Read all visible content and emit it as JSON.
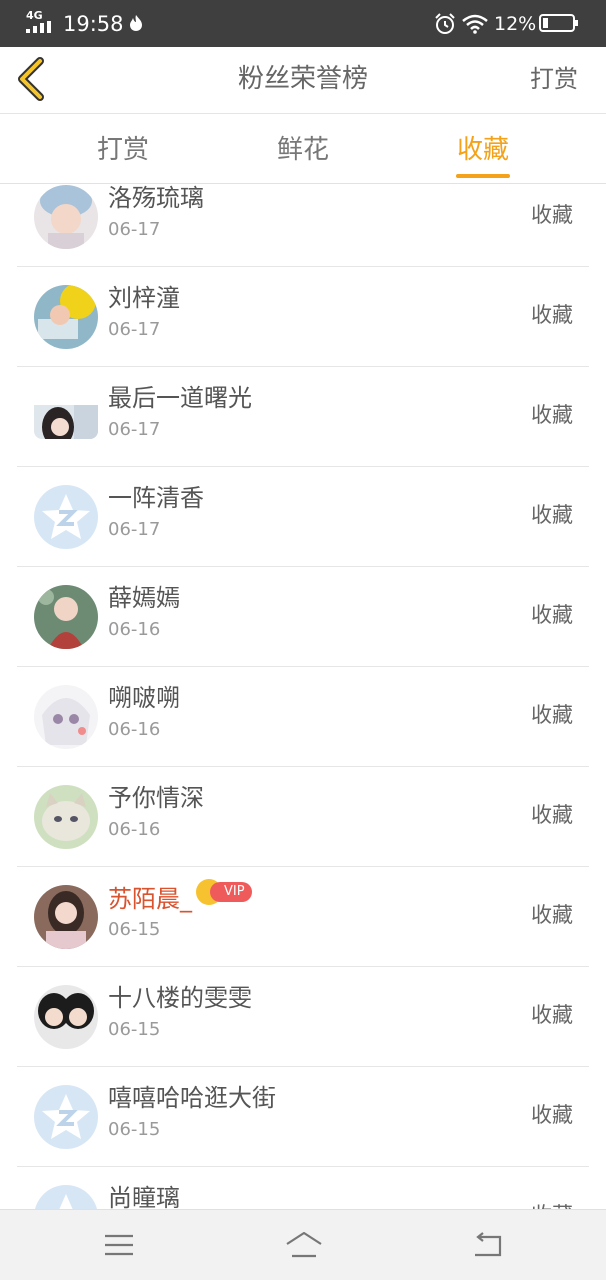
{
  "status_bar": {
    "network": "4G",
    "time": "19:58",
    "battery": "12%"
  },
  "header": {
    "title": "粉丝荣誉榜",
    "right_action": "打赏",
    "back_icon": "chevron-left-icon"
  },
  "tabs": [
    {
      "label": "打赏",
      "active": false
    },
    {
      "label": "鲜花",
      "active": false
    },
    {
      "label": "收藏",
      "active": true
    }
  ],
  "colors": {
    "accent": "#f3a21a",
    "vip_name": "#d9532f",
    "status_bar": "#3f3f3f"
  },
  "list": [
    {
      "name": "洛殇琉璃",
      "date": "06-17",
      "action": "收藏",
      "vip": false
    },
    {
      "name": "刘梓潼",
      "date": "06-17",
      "action": "收藏",
      "vip": false
    },
    {
      "name": "最后一道曙光",
      "date": "06-17",
      "action": "收藏",
      "vip": false
    },
    {
      "name": "一阵清香",
      "date": "06-17",
      "action": "收藏",
      "vip": false
    },
    {
      "name": "薛嫣嫣",
      "date": "06-16",
      "action": "收藏",
      "vip": false
    },
    {
      "name": "嗍啵嗍",
      "date": "06-16",
      "action": "收藏",
      "vip": false
    },
    {
      "name": "予你情深",
      "date": "06-16",
      "action": "收藏",
      "vip": false
    },
    {
      "name": "苏陌晨_",
      "date": "06-15",
      "action": "收藏",
      "vip": true,
      "vip_label": "VIP"
    },
    {
      "name": "十八楼的雯雯",
      "date": "06-15",
      "action": "收藏",
      "vip": false
    },
    {
      "name": "嘻嘻哈哈逛大街",
      "date": "06-15",
      "action": "收藏",
      "vip": false
    },
    {
      "name": "尚瞳璃",
      "date": "",
      "action": "收藏",
      "vip": false
    }
  ],
  "navbar": {
    "icons": [
      "menu-icon",
      "home-icon",
      "back-icon"
    ]
  }
}
